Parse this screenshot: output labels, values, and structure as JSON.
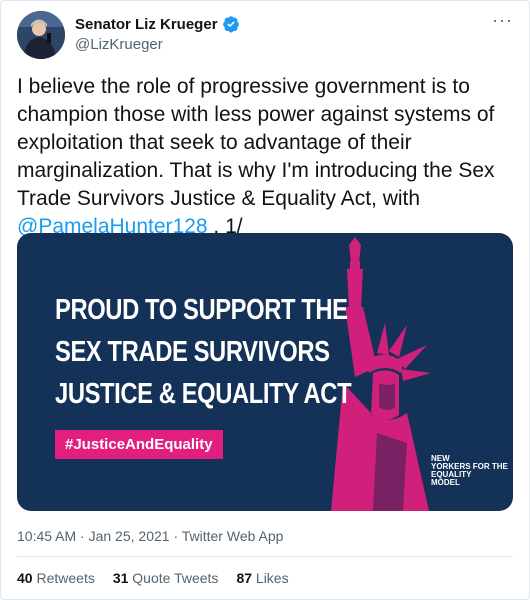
{
  "tweet": {
    "author_name": "Senator Liz Krueger",
    "handle": "@LizKrueger",
    "more_label": "···",
    "text_before_mention": "I believe the role of progressive government is to champion those with less power against systems of exploitation that seek to advantage of their marginalization. That is why I'm introducing the Sex Trade Survivors Justice & Equality Act, with ",
    "mention": "@PamelaHunter128",
    "text_after_mention": " . 1/",
    "timestamp": "10:45 AM · Jan 25, 2021 · Twitter Web App"
  },
  "media": {
    "headline_line1": "PROUD TO SUPPORT THE",
    "headline_line2": "SEX TRADE SURVIVORS",
    "headline_line3": "JUSTICE & EQUALITY ACT",
    "hashtag": "#JusticeAndEquality",
    "logo_line1": "NEW",
    "logo_line2": "YORKERS FOR THE",
    "logo_line3": "EQUALITY",
    "logo_line4": "MODEL"
  },
  "stats": {
    "retweets_count": "40",
    "retweets_label": "Retweets",
    "quotes_count": "31",
    "quotes_label": "Quote Tweets",
    "likes_count": "87",
    "likes_label": "Likes"
  },
  "colors": {
    "media_background": "#143158",
    "accent_pink": "#e21f7e",
    "link_blue": "#1d9bf0",
    "verified_blue": "#1d9bf0"
  },
  "icons": [
    "verified-badge-icon",
    "more-options-icon"
  ]
}
